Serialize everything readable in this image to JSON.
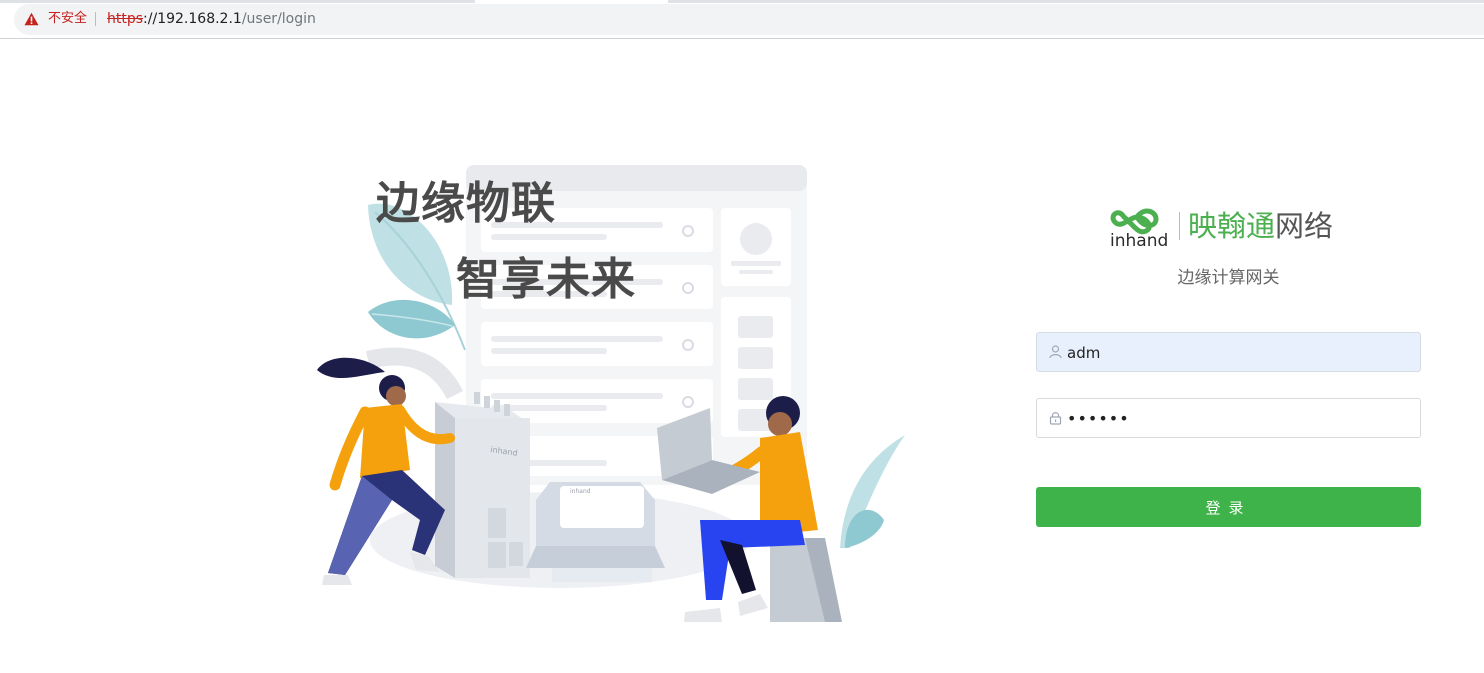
{
  "browser": {
    "security_label": "不安全",
    "url_scheme": "https",
    "url_sep": "://",
    "url_host": "192.168.2.1",
    "url_path": "/user/login"
  },
  "hero": {
    "slogan_line1": "边缘物联",
    "slogan_line2": "智享未来",
    "device_brand": "inhand"
  },
  "brand": {
    "logo_text": "inhand",
    "name_green": "映翰通",
    "name_dark": "网络",
    "product": "边缘计算网关"
  },
  "login": {
    "username_value": "adm",
    "password_mask": "••••••",
    "submit_label": "登录"
  },
  "colors": {
    "accent_green": "#3db34a",
    "insecure_red": "#c5221f",
    "autofill_bg": "#e8f0fe"
  }
}
